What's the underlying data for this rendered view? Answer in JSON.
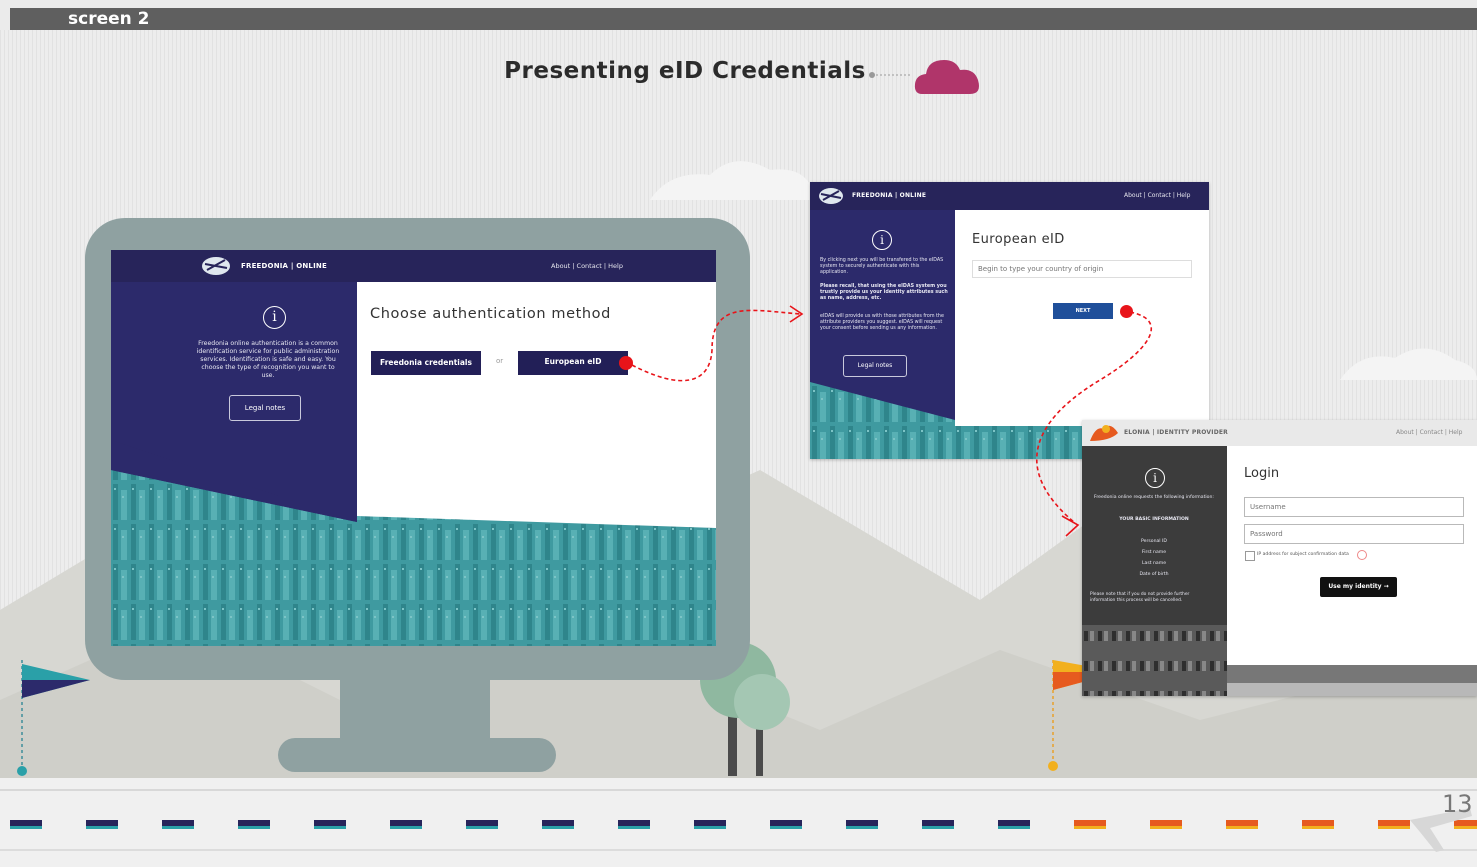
{
  "slide": {
    "header": "screen 2",
    "title": "Presenting eID Credentials",
    "page_number": "13"
  },
  "colors": {
    "navy": "#27245a",
    "teal": "#3d9ba0",
    "accent_red": "#e8141a",
    "cloud": "#b0356a"
  },
  "screen1": {
    "brand": "FREEDONIA | ONLINE",
    "links": "About | Contact | Help",
    "info_icon": "info-icon",
    "side_text": "Freedonia online authentication is a common identification service for public administration services. Identification is safe and easy. You choose the type of recognition you want to use.",
    "legal_button": "Legal notes",
    "heading": "Choose authentication method",
    "btn_freedonia": "Freedonia credentials",
    "or": "or",
    "btn_european": "European eID"
  },
  "screen2": {
    "brand": "FREEDONIA | ONLINE",
    "links": "About | Contact | Help",
    "side_text_1": "By clicking next you will be transfered to the eIDAS system to securely authenticate with this application.",
    "side_text_2": "Please recall, that using the eIDAS system you trustly provide us your identity attributes such as name, address, etc.",
    "side_text_3": "eIDAS will provide us with those attributes from the attribute providers you suggest. eIDAS will request your consent before sending us any information.",
    "legal_button": "Legal notes",
    "heading": "European eID",
    "country_placeholder": "Begin to type your country of origin",
    "next_button": "NEXT"
  },
  "screen3": {
    "brand": "ELONIA | IDENTITY PROVIDER",
    "links": "About | Contact | Help",
    "request_text": "Freedonia online requests the following information:",
    "section_title": "YOUR BASIC INFORMATION",
    "attributes": [
      "Personal ID",
      "First name",
      "Last name",
      "Date of birth"
    ],
    "note": "Please note that if you do not provide further information this process will be cancelled.",
    "heading": "Login",
    "username_placeholder": "Username",
    "password_placeholder": "Password",
    "checkbox_label": "IP address for subject confirmation data",
    "submit_button": "Use my identity →"
  }
}
